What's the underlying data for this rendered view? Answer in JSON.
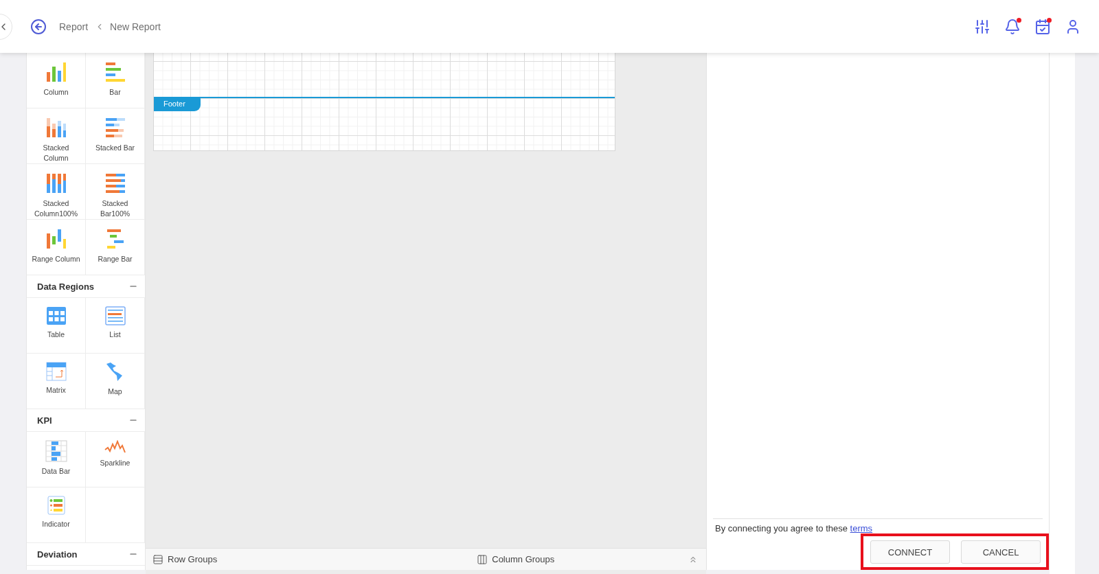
{
  "header": {
    "breadcrumb": [
      "Report",
      "New Report"
    ]
  },
  "sidebar": {
    "groups": [
      {
        "items": [
          "Column",
          "Bar",
          "Stacked Column",
          "Stacked Bar",
          "Stacked Column100%",
          "Stacked Bar100%",
          "Range Column",
          "Range Bar"
        ]
      },
      {
        "title": "Data Regions",
        "expanded": true,
        "items": [
          "Table",
          "List",
          "Matrix",
          "Map"
        ]
      },
      {
        "title": "KPI",
        "expanded": true,
        "items": [
          "Data Bar",
          "Sparkline",
          "Indicator"
        ]
      },
      {
        "title": "Deviation",
        "expanded": true
      }
    ]
  },
  "canvas": {
    "band": "Footer"
  },
  "bottom_bar": {
    "row_groups": "Row Groups",
    "column_groups": "Column Groups"
  },
  "panel": {
    "terms_text": "By connecting you agree to these",
    "terms_link": "terms",
    "buttons": [
      "CONNECT",
      "CANCEL"
    ]
  }
}
